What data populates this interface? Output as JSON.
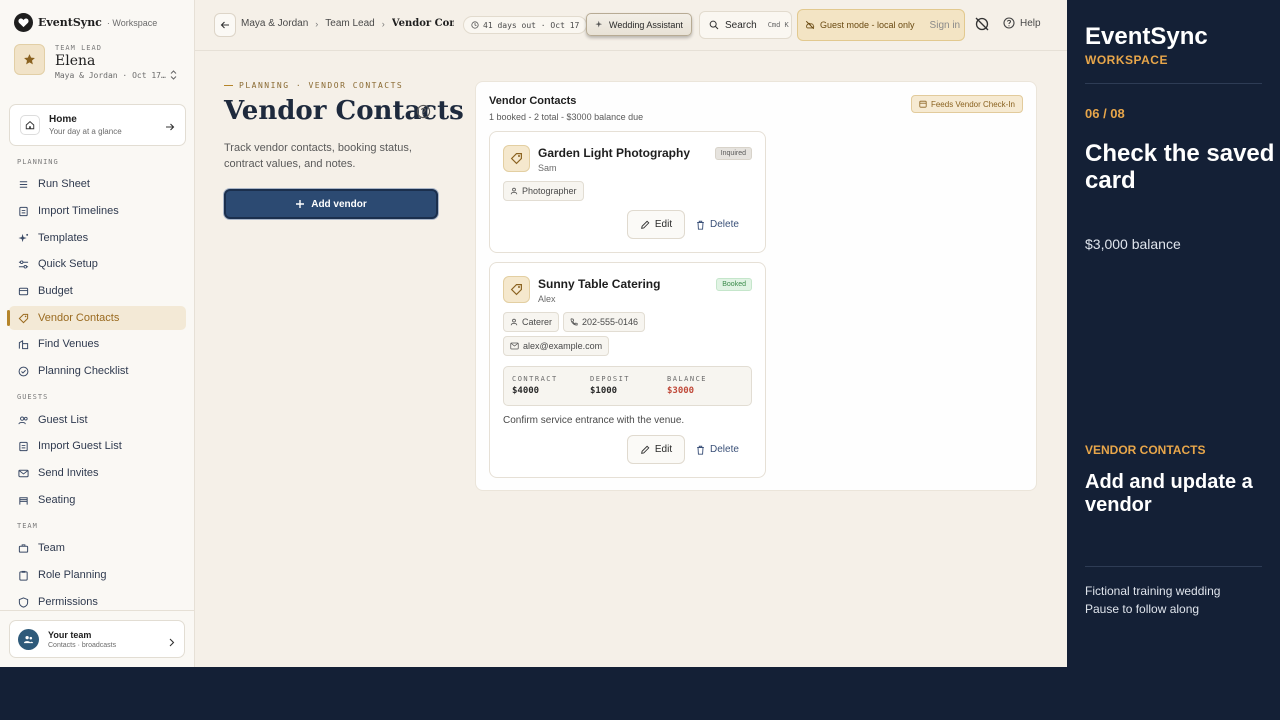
{
  "brand": {
    "name": "EventSync",
    "workspace": "· Workspace"
  },
  "profile": {
    "role": "TEAM LEAD",
    "name": "Elena",
    "event": "Maya & Jordan · Oct 17, 2026"
  },
  "home": {
    "title": "Home",
    "subtitle": "Your day at a glance"
  },
  "sidebar": {
    "planning_label": "PLANNING",
    "planning_items": [
      {
        "label": "Run Sheet",
        "icon": "run-sheet-icon"
      },
      {
        "label": "Import Timelines",
        "icon": "import-icon"
      },
      {
        "label": "Templates",
        "icon": "sparkle-icon"
      },
      {
        "label": "Quick Setup",
        "icon": "sliders-icon"
      },
      {
        "label": "Budget",
        "icon": "wallet-icon"
      },
      {
        "label": "Vendor Contacts",
        "icon": "tag-icon",
        "active": true
      },
      {
        "label": "Find Venues",
        "icon": "building-icon"
      },
      {
        "label": "Planning Checklist",
        "icon": "check-circle-icon"
      }
    ],
    "guests_label": "GUESTS",
    "guest_items": [
      {
        "label": "Guest List",
        "icon": "users-icon"
      },
      {
        "label": "Import Guest List",
        "icon": "import-icon"
      },
      {
        "label": "Send Invites",
        "icon": "mail-icon"
      },
      {
        "label": "Seating",
        "icon": "chair-icon"
      }
    ],
    "team_label": "TEAM",
    "team_items": [
      {
        "label": "Team",
        "icon": "briefcase-icon"
      },
      {
        "label": "Role Planning",
        "icon": "clipboard-icon"
      },
      {
        "label": "Permissions",
        "icon": "shield-icon"
      }
    ],
    "team_card": {
      "title": "Your team",
      "subtitle": "Contacts · broadcasts"
    }
  },
  "topbar": {
    "crumbs": [
      "Maya & Jordan",
      "Team Lead",
      "Vendor Contacts"
    ],
    "countdown": "41 days out · Oct 17",
    "assistant": "Wedding Assistant",
    "search": "Search",
    "search_kbd": "Cmd K",
    "guest_mode": "Guest mode - local only",
    "sign_in": "Sign in",
    "help": "Help"
  },
  "page": {
    "eyebrow": "PLANNING · VENDOR CONTACTS",
    "title": "Vendor Contacts",
    "description": "Track vendor contacts, booking status, contract values, and notes.",
    "add_button": "Add vendor"
  },
  "panel": {
    "title": "Vendor Contacts",
    "subtitle": "1 booked - 2 total - $3000 balance due",
    "feeds": "Feeds Vendor Check-In"
  },
  "vendors": [
    {
      "name": "Garden Light Photography",
      "contact": "Sam",
      "status": "Inquired",
      "category": "Photographer",
      "edit": "Edit",
      "delete": "Delete"
    },
    {
      "name": "Sunny Table Catering",
      "contact": "Alex",
      "status": "Booked",
      "category": "Caterer",
      "phone": "202-555-0146",
      "email": "alex@example.com",
      "contract_label": "CONTRACT",
      "contract": "$4000",
      "deposit_label": "DEPOSIT",
      "deposit": "$1000",
      "balance_label": "BALANCE",
      "balance": "$3000",
      "note": "Confirm service entrance with the venue.",
      "edit": "Edit",
      "delete": "Delete"
    }
  ],
  "overlay": {
    "brand": "EventSync",
    "workspace": "WORKSPACE",
    "step": "06 / 08",
    "heading": "Check the saved card",
    "balance": "$3,000 balance",
    "section": "VENDOR CONTACTS",
    "action": "Add and update a vendor",
    "foot1": "Fictional training wedding",
    "foot2": "Pause to follow along"
  },
  "colors": {
    "accent": "#b5852a",
    "navy": "#142036",
    "primary_button": "#2c4a72",
    "balance_red": "#c04a3a",
    "booked_green": "#3a8a4a"
  }
}
